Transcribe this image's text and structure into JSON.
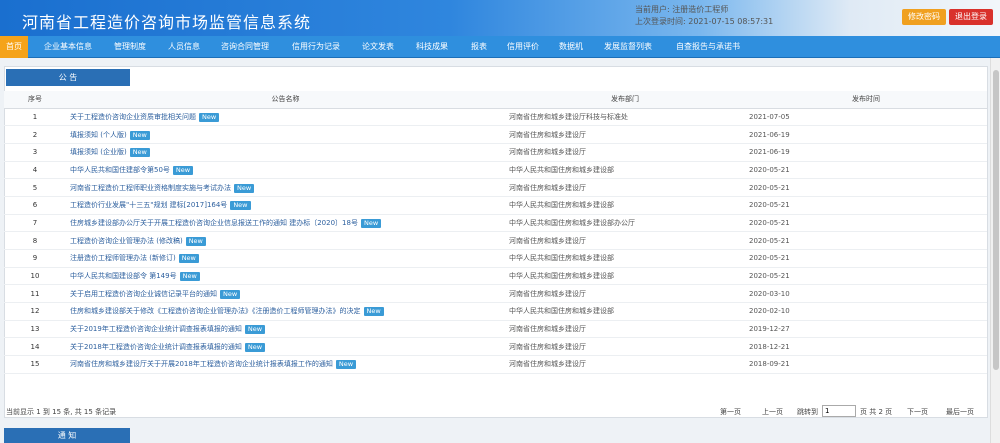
{
  "header": {
    "title": "河南省工程造价咨询市场监管信息系统",
    "user_line1": "当前用户: 注册造价工程师",
    "user_line2": "上次登录时间: 2021-07-15 08:57:31",
    "settings_label": "修改密码",
    "logout_label": "退出登录"
  },
  "nav": {
    "items": [
      "首页",
      "企业基本信息",
      "管理制度",
      "人员信息",
      "咨询合同管理",
      "信用行为记录",
      "论文发表",
      "科技成果",
      "报表",
      "信用评价",
      "数据机",
      "发展监督列表",
      "自查报告与承诺书"
    ]
  },
  "notice": {
    "section_title": "公  告",
    "columns": [
      "序号",
      "公告名称",
      "发布部门",
      "发布时间"
    ],
    "new_label": "New",
    "rows": [
      {
        "idx": "1",
        "name": "关于工程造价咨询企业资质审批相关问题",
        "dept": "河南省住房和城乡建设厅科技与标准处",
        "date": "2021-07-05"
      },
      {
        "idx": "2",
        "name": "填报须知 (个人版)",
        "dept": "河南省住房和城乡建设厅",
        "date": "2021-06-19"
      },
      {
        "idx": "3",
        "name": "填报须知 (企业版)",
        "dept": "河南省住房和城乡建设厅",
        "date": "2021-06-19"
      },
      {
        "idx": "4",
        "name": "中华人民共和国住建部令第50号",
        "dept": "中华人民共和国住房和城乡建设部",
        "date": "2020-05-21"
      },
      {
        "idx": "5",
        "name": "河南省工程造价工程师职业资格制度实施与考试办法",
        "dept": "河南省住房和城乡建设厅",
        "date": "2020-05-21"
      },
      {
        "idx": "6",
        "name": "工程造价行业发展\"十三五\"规划 建标[2017]164号",
        "dept": "中华人民共和国住房和城乡建设部",
        "date": "2020-05-21"
      },
      {
        "idx": "7",
        "name": "住房城乡建设部办公厅关于开展工程造价咨询企业信息报送工作的通知 建办标〔2020〕18号",
        "dept": "中华人民共和国住房和城乡建设部办公厅",
        "date": "2020-05-21"
      },
      {
        "idx": "8",
        "name": "工程造价咨询企业管理办法 (修改稿)",
        "dept": "河南省住房和城乡建设厅",
        "date": "2020-05-21"
      },
      {
        "idx": "9",
        "name": "注册造价工程师管理办法 (新修订)",
        "dept": "中华人民共和国住房和城乡建设部",
        "date": "2020-05-21"
      },
      {
        "idx": "10",
        "name": "中华人民共和国建设部令 第149号",
        "dept": "中华人民共和国住房和城乡建设部",
        "date": "2020-05-21"
      },
      {
        "idx": "11",
        "name": "关于启用工程造价咨询企业诚信记录平台的通知",
        "dept": "河南省住房和城乡建设厅",
        "date": "2020-03-10"
      },
      {
        "idx": "12",
        "name": "住房和城乡建设部关于修改《工程造价咨询企业管理办法》《注册造价工程师管理办法》的决定",
        "dept": "中华人民共和国住房和城乡建设部",
        "date": "2020-02-10"
      },
      {
        "idx": "13",
        "name": "关于2019年工程造价咨询企业统计调查报表填报的通知",
        "dept": "河南省住房和城乡建设厅",
        "date": "2019-12-27"
      },
      {
        "idx": "14",
        "name": "关于2018年工程造价咨询企业统计调查报表填报的通知",
        "dept": "河南省住房和城乡建设厅",
        "date": "2018-12-21"
      },
      {
        "idx": "15",
        "name": "河南省住房和城乡建设厅关于开展2018年工程造价咨询企业统计报表填报工作的通知",
        "dept": "河南省住房和城乡建设厅",
        "date": "2018-09-21"
      }
    ]
  },
  "pager": {
    "summary": "当前显示 1 到 15 条, 共 15 条记录",
    "first": "第一页",
    "prev": "上一页",
    "goto": "跳转到",
    "page_value": "1",
    "page_suffix": "页 共 2 页",
    "next": "下一页",
    "last": "最后一页"
  },
  "second_section": {
    "title": "通  知"
  }
}
